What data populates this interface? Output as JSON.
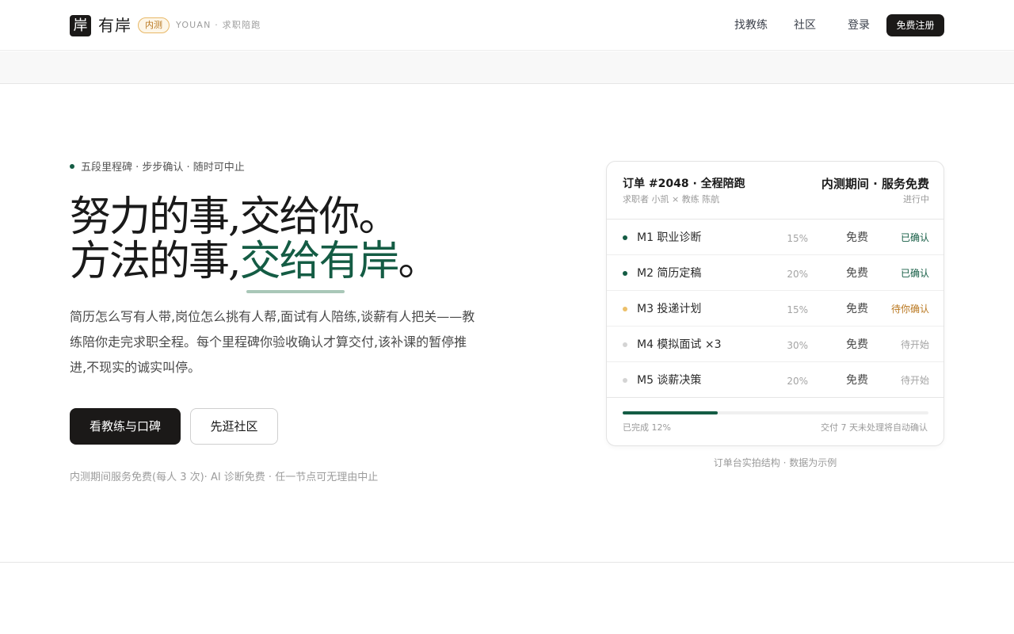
{
  "header": {
    "logo_glyph": "岸",
    "brand": "有岸",
    "badge": "内测",
    "tagline": "YOUAN · 求职陪跑",
    "nav": {
      "coach": "找教练",
      "community": "社区",
      "login": "登录",
      "register": "免费注册"
    }
  },
  "hero": {
    "eyebrow": "五段里程碑 · 步步确认 · 随时可中止",
    "headline_line1": "努力的事,交给你。",
    "headline_line2_prefix": "方法的事,",
    "headline_line2_accent": "交给有岸",
    "headline_line2_suffix": "。",
    "description": "简历怎么写有人带,岗位怎么挑有人帮,面试有人陪练,谈薪有人把关——教练陪你走完求职全程。每个里程碑你验收确认才算交付,该补课的暂停推进,不现实的诚实叫停。",
    "primary_button": "看教练与口碑",
    "secondary_button": "先逛社区",
    "note": "内测期间服务免费(每人 3 次)· AI 诊断免费 · 任一节点可无理由中止"
  },
  "order": {
    "title": "订单 #2048 · 全程陪跑",
    "subtitle": "求职者 小凯 × 教练 陈航",
    "promo": "内测期间 · 服务免费",
    "status": "进行中",
    "milestones": [
      {
        "name": "M1 职业诊断",
        "pct": "15%",
        "price": "免费",
        "state": "已确认",
        "status_color": "#145c44",
        "dot_color": "#145c44"
      },
      {
        "name": "M2 简历定稿",
        "pct": "20%",
        "price": "免费",
        "state": "已确认",
        "status_color": "#145c44",
        "dot_color": "#145c44"
      },
      {
        "name": "M3 投递计划",
        "pct": "15%",
        "price": "免费",
        "state": "待你确认",
        "status_color": "#b9771f",
        "dot_color": "#ecc06a"
      },
      {
        "name": "M4 模拟面试 ×3",
        "pct": "30%",
        "price": "免费",
        "state": "待开始",
        "status_color": "#a4a4a4",
        "dot_color": "#d4d4d4"
      },
      {
        "name": "M5 谈薪决策",
        "pct": "20%",
        "price": "免费",
        "state": "待开始",
        "status_color": "#a4a4a4",
        "dot_color": "#d4d4d4"
      }
    ],
    "progress_fraction": 0.31,
    "done_text": "已完成 12%",
    "auto_confirm_text": "交付 7 天未处理将自动确认"
  },
  "caption": "订单台实拍结构 · 数据为示例",
  "colors": {
    "accent": "#145c44",
    "dark": "#1b1918",
    "warning": "#b9771f"
  }
}
